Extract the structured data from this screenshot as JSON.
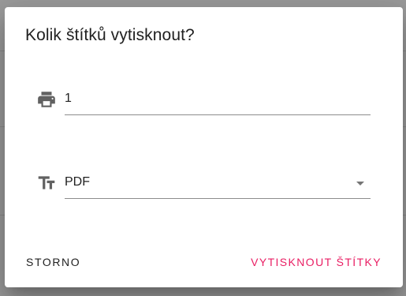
{
  "dialog": {
    "title": "Kolik štítků vytisknout?",
    "copies_field": {
      "icon": "printer-icon",
      "value": "1"
    },
    "format_field": {
      "icon": "text-format-icon",
      "value": "PDF"
    },
    "cancel_label": "STORNO",
    "confirm_label": "VYTISKNOUT ŠTÍTKY"
  },
  "colors": {
    "accent": "#e91e63",
    "backdrop": "#9b9b9b",
    "text": "#212121",
    "icon": "#616161"
  }
}
